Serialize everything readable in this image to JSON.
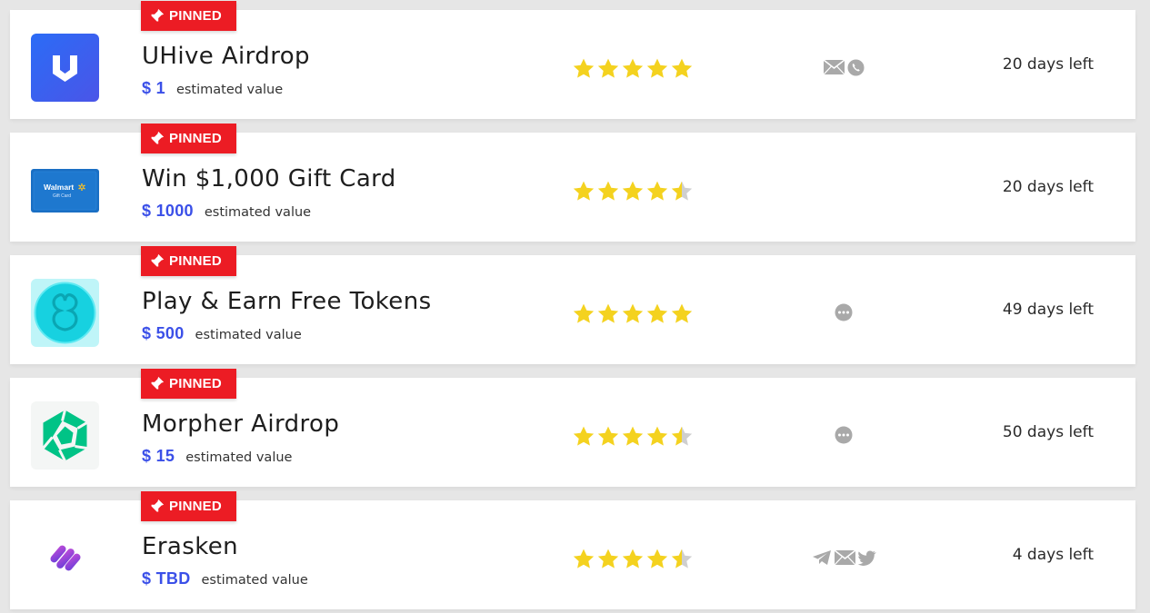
{
  "colors": {
    "pinned_bg": "#ec1c24",
    "value_text": "#3b50e8",
    "star_fill": "#f4d21f",
    "star_empty": "#cfcfcf",
    "contact_icon": "#a9a9a9"
  },
  "listings": [
    {
      "badge": "PINNED",
      "title": "UHive Airdrop",
      "value": "$ 1",
      "value_label": "estimated value",
      "rating": 5,
      "contact_icons": [
        "email-icon",
        "phone-icon"
      ],
      "days_left": "20 days left",
      "logo": "uhive-logo"
    },
    {
      "badge": "PINNED",
      "title": "Win $1,000 Gift Card",
      "value": "$ 1000",
      "value_label": "estimated value",
      "rating": 4.5,
      "contact_icons": [],
      "days_left": "20 days left",
      "logo": "walmart-gift-card-logo",
      "logo_text": {
        "brand": "Walmart",
        "sub": "Gift Card"
      }
    },
    {
      "badge": "PINNED",
      "title": "Play & Earn Free Tokens",
      "value": "$ 500",
      "value_label": "estimated value",
      "rating": 5,
      "contact_icons": [
        "chat-icon"
      ],
      "days_left": "49 days left",
      "logo": "cyan-token-logo"
    },
    {
      "badge": "PINNED",
      "title": "Morpher Airdrop",
      "value": "$ 15",
      "value_label": "estimated value",
      "rating": 4.5,
      "contact_icons": [
        "chat-icon"
      ],
      "days_left": "50 days left",
      "logo": "morpher-logo"
    },
    {
      "badge": "PINNED",
      "title": "Erasken",
      "value": "$ TBD",
      "value_label": "estimated value",
      "rating": 4.5,
      "contact_icons": [
        "telegram-icon",
        "email-icon",
        "twitter-icon"
      ],
      "days_left": "4 days left",
      "logo": "erasken-logo"
    }
  ]
}
